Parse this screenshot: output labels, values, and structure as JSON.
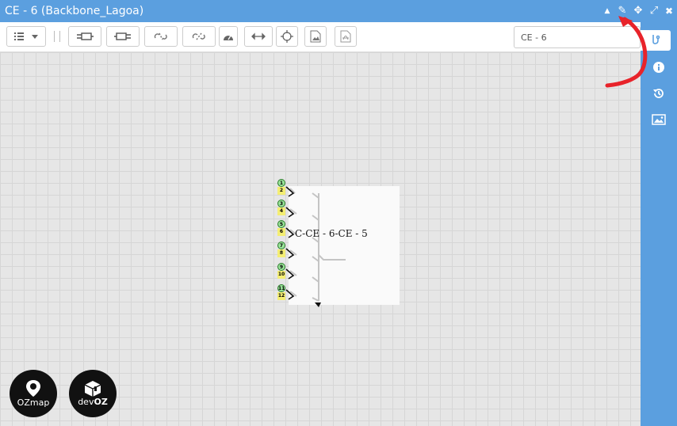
{
  "window": {
    "title": "CE - 6 (Backbone_Lagoa)"
  },
  "title_controls": [
    {
      "name": "collapse-icon",
      "glyph": "▲"
    },
    {
      "name": "pencil-icon",
      "glyph": "✎"
    },
    {
      "name": "move-icon",
      "glyph": "✥"
    },
    {
      "name": "expand-icon",
      "glyph": "⤢"
    },
    {
      "name": "close-icon",
      "glyph": "✖"
    }
  ],
  "toolbar": {
    "search_value": "CE - 6"
  },
  "diagram": {
    "box_label": "C-CE - 6-CE - 5",
    "ports": [
      "1",
      "2",
      "3",
      "4",
      "5",
      "6",
      "7",
      "8",
      "9",
      "10",
      "11",
      "12"
    ]
  },
  "logos": {
    "ozmap_label": "OZmap",
    "devoz_label_prefix": "dev",
    "devoz_label_suffix": "OZ"
  },
  "colors": {
    "titlebar": "#5b9fdf",
    "sidebar": "#5b9fdf",
    "annotation_arrow": "#e8232a"
  }
}
